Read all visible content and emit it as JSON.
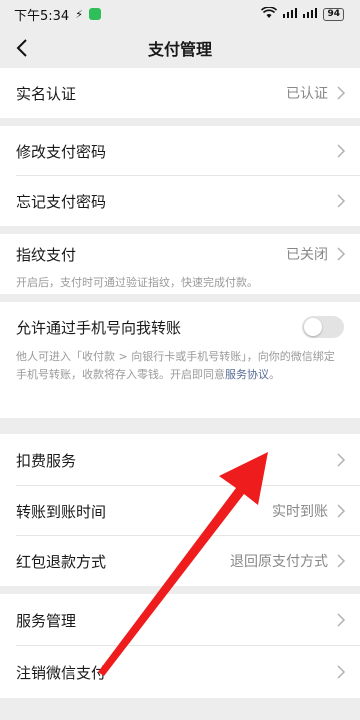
{
  "status_bar": {
    "time": "下午5:34",
    "battery": "94"
  },
  "nav": {
    "title": "支付管理"
  },
  "items": {
    "realname": {
      "label": "实名认证",
      "value": "已认证"
    },
    "change_pwd": {
      "label": "修改支付密码"
    },
    "forgot_pwd": {
      "label": "忘记支付密码"
    },
    "fingerprint": {
      "label": "指纹支付",
      "value": "已关闭",
      "desc": "开启后，支付时可通过验证指纹，快速完成付款。"
    },
    "phone_transfer": {
      "label": "允许通过手机号向我转账",
      "desc_part1": "他人可进入「收付款 > 向银行卡或手机号转账」，向你的微信绑定手机号转账，收款将存入零钱。开启即同意",
      "link": "服务协议",
      "desc_part2": "。",
      "toggle_on": false
    },
    "deduct": {
      "label": "扣费服务"
    },
    "transfer_time": {
      "label": "转账到账时间",
      "value": "实时到账"
    },
    "redpacket_refund": {
      "label": "红包退款方式",
      "value": "退回原支付方式"
    },
    "service_mgmt": {
      "label": "服务管理"
    },
    "cancel_pay": {
      "label": "注销微信支付"
    }
  },
  "colors": {
    "accent_link": "#576b95",
    "annotation_arrow": "#ee1c1c",
    "background": "#ededed"
  }
}
